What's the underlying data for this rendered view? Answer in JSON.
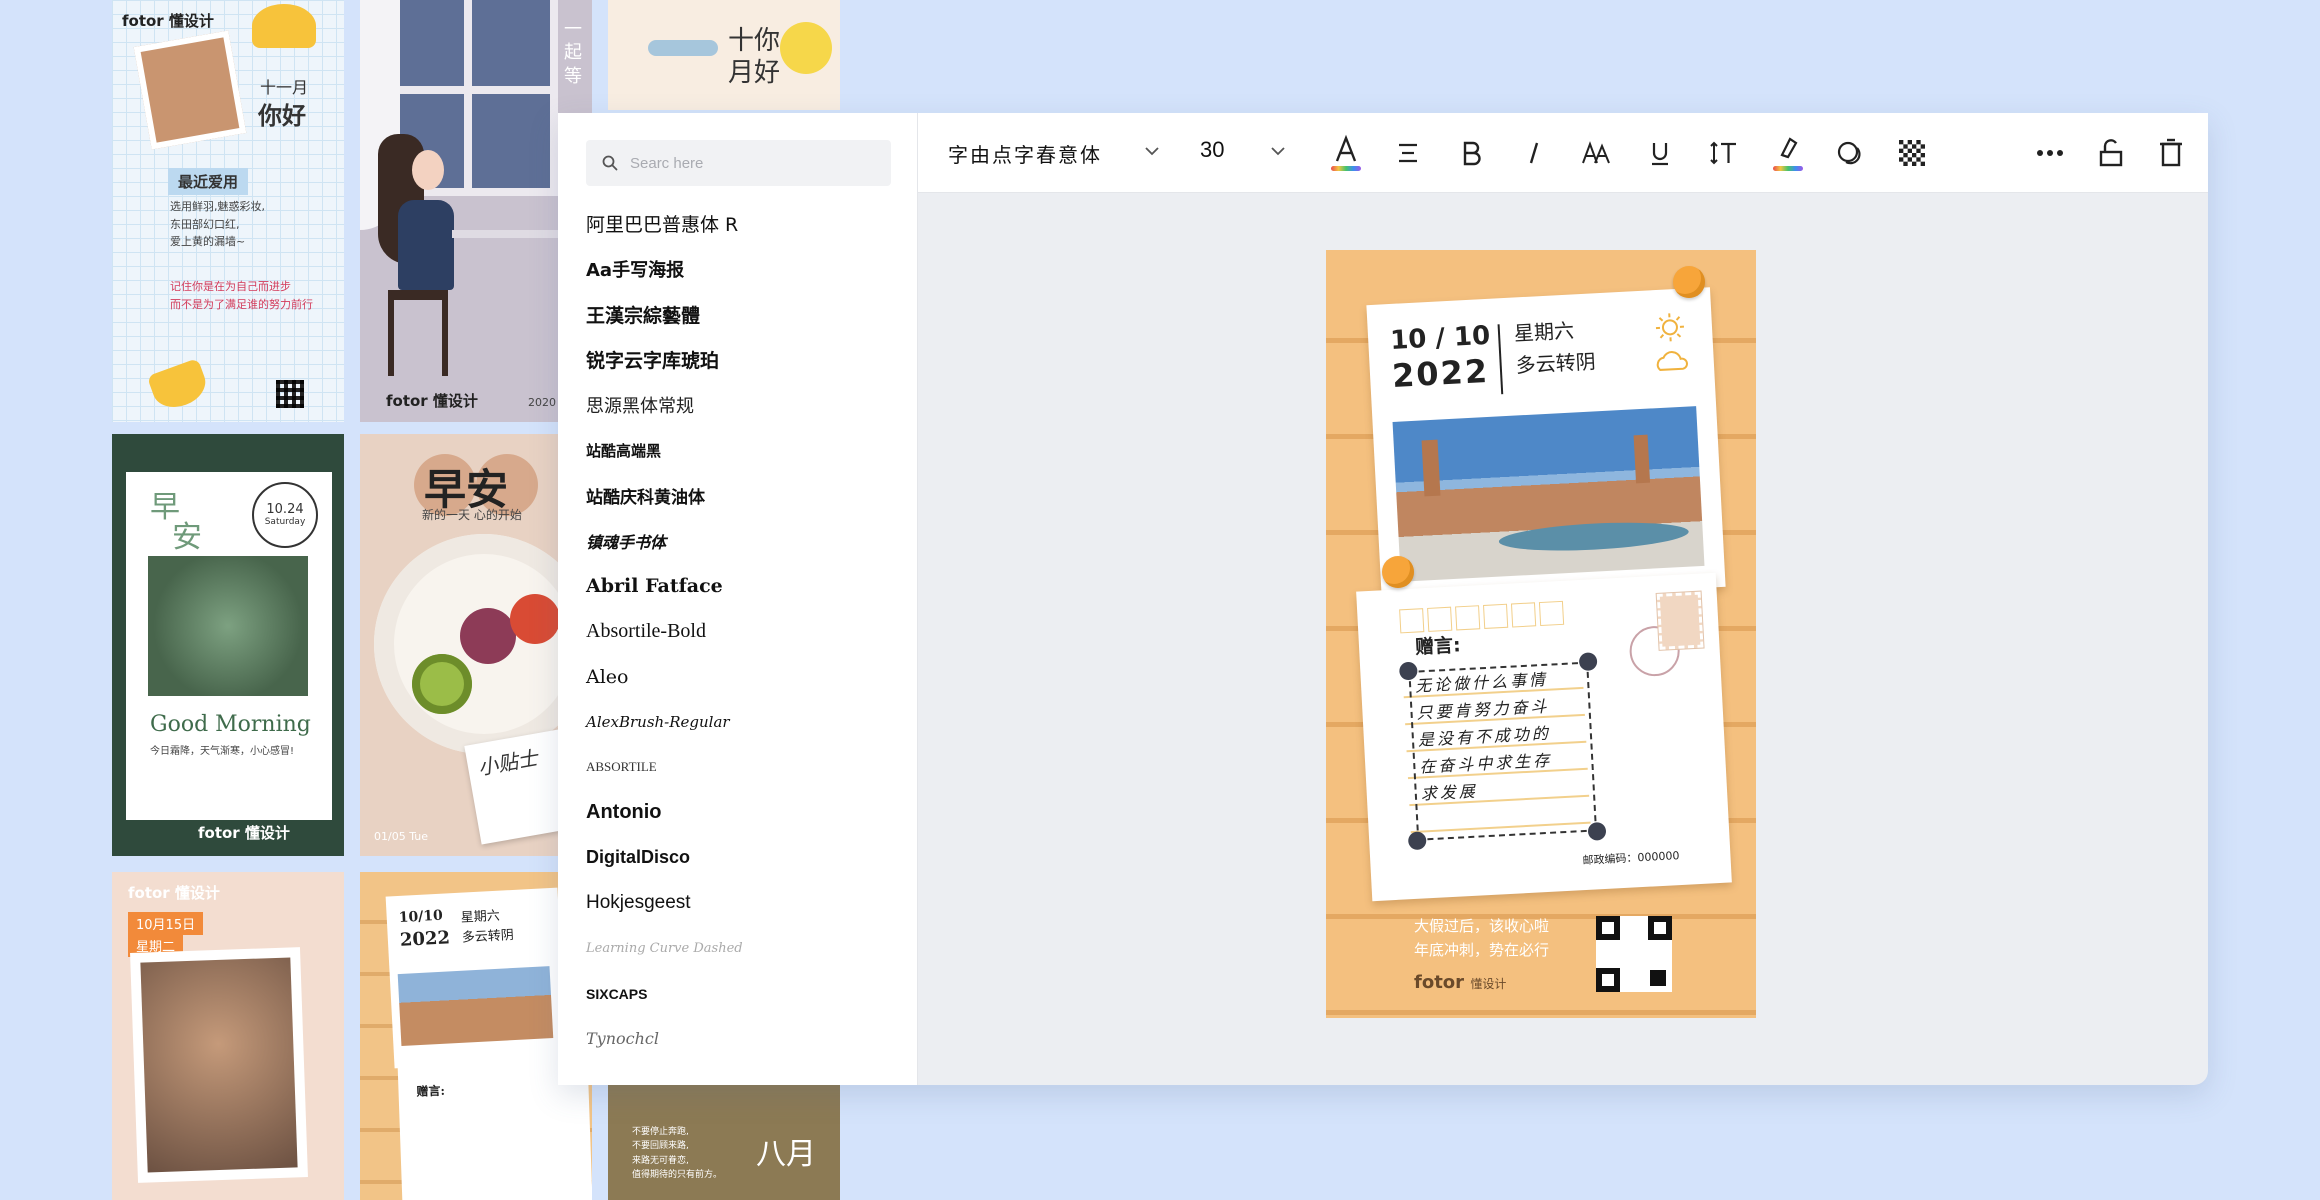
{
  "gallery": {
    "t1": {
      "brand": "fotor 懂设计",
      "title_month": "十一月",
      "title_hello": "你好",
      "tag": "最近爱用",
      "lines": [
        "选用鲜羽,魅惑彩妆,",
        "东田部幻口红,",
        "爱上黄的漏墙~"
      ],
      "footer1": "记住你是在为自己而进步",
      "footer2": "而不是为了满足谁的努力前行"
    },
    "t2": {
      "vertical": "一起等",
      "brand": "fotor 懂设计",
      "date": "2020"
    },
    "t3": {
      "title1": "十你",
      "title2": "月好"
    },
    "t4": {
      "early": "早",
      "morning": "安",
      "date": "10.24",
      "weekday": "Saturday",
      "greeting": "Good Morning",
      "sub": "今日霜降，天气渐寒，小心感冒!",
      "brand": "fotor 懂设计"
    },
    "t5": {
      "title": "早安",
      "sub": "新的一天 心的开始",
      "note": "小贴士",
      "date": "01/05 Tue"
    },
    "t7": {
      "brand": "fotor 懂设计",
      "date": "10月15日",
      "weekday": "星期二"
    },
    "t8": {
      "date": "10/10",
      "year": "2022",
      "weekday": "星期六",
      "weather": "多云转阴",
      "gift": "赠言:"
    },
    "t9": {
      "title": "八月",
      "lines": [
        "不要停止奔跑,",
        "不要回顾来路,",
        "来路无可眷恋,",
        "值得期待的只有前方。"
      ]
    }
  },
  "search": {
    "placeholder": "Searc here"
  },
  "fonts": [
    {
      "name": "阿里巴巴普惠体 R",
      "family": "\"DejaVu Sans\", sans-serif",
      "size": 19,
      "weight": "normal",
      "style": "normal",
      "color": "#111"
    },
    {
      "name": "Aa手写海报",
      "family": "\"DejaVu Sans\", sans-serif",
      "size": 18,
      "weight": "bold",
      "style": "normal",
      "color": "#111"
    },
    {
      "name": "王漢宗綜藝體",
      "family": "\"DejaVu Serif\", serif",
      "size": 19,
      "weight": "bold",
      "style": "normal",
      "color": "#111"
    },
    {
      "name": "锐字云字库琥珀",
      "family": "\"DejaVu Sans\", sans-serif",
      "size": 19,
      "weight": "bold",
      "style": "normal",
      "color": "#111"
    },
    {
      "name": "思源黑体常规",
      "family": "\"DejaVu Sans\", sans-serif",
      "size": 18,
      "weight": "normal",
      "style": "normal",
      "color": "#222"
    },
    {
      "name": "站酷高端黑",
      "family": "\"DejaVu Sans\", sans-serif",
      "size": 15,
      "weight": "bold",
      "style": "normal",
      "color": "#111"
    },
    {
      "name": "站酷庆科黄油体",
      "family": "\"DejaVu Sans\", sans-serif",
      "size": 17,
      "weight": "bold",
      "style": "normal",
      "color": "#111"
    },
    {
      "name": "镇魂手书体",
      "family": "\"DejaVu Serif\", serif",
      "size": 16,
      "weight": "bold",
      "style": "italic",
      "color": "#111"
    },
    {
      "name": "Abril Fatface",
      "family": "\"DejaVu Serif\", serif",
      "size": 19,
      "weight": "bold",
      "style": "normal",
      "color": "#111"
    },
    {
      "name": "Absortile-Bold",
      "family": "\"Liberation Serif\", serif",
      "size": 20,
      "weight": "normal",
      "style": "normal",
      "color": "#111"
    },
    {
      "name": "Aleo",
      "family": "\"DejaVu Serif\", serif",
      "size": 19,
      "weight": "normal",
      "style": "normal",
      "color": "#111"
    },
    {
      "name": "AlexBrush-Regular",
      "family": "\"DejaVu Serif\", serif",
      "size": 15,
      "weight": "normal",
      "style": "italic",
      "color": "#111"
    },
    {
      "name": "ABSORTILE",
      "family": "\"Liberation Serif\", serif",
      "size": 13,
      "weight": "normal",
      "style": "normal",
      "color": "#333"
    },
    {
      "name": "Antonio",
      "family": "\"Liberation Sans\", sans-serif",
      "size": 20,
      "weight": "bold",
      "style": "normal",
      "color": "#111"
    },
    {
      "name": "DigitalDisco",
      "family": "\"Liberation Sans\", sans-serif",
      "size": 18,
      "weight": "bold",
      "style": "normal",
      "color": "#111"
    },
    {
      "name": "Hokjesgeest",
      "family": "\"Liberation Sans\", sans-serif",
      "size": 19,
      "weight": "normal",
      "style": "normal",
      "color": "#111"
    },
    {
      "name": "Learning Curve Dashed",
      "family": "\"DejaVu Serif\", serif",
      "size": 13,
      "weight": "normal",
      "style": "italic",
      "color": "#aaa"
    },
    {
      "name": "SIXCAPS",
      "family": "\"Liberation Sans\", sans-serif",
      "size": 14,
      "weight": "bold",
      "style": "normal",
      "color": "#111"
    },
    {
      "name": "Tynochcl",
      "family": "\"DejaVu Serif\", serif",
      "size": 16,
      "weight": "normal",
      "style": "italic",
      "color": "#666"
    }
  ],
  "toolbar": {
    "font_name": "字由点字春意体",
    "font_size": "30",
    "icons": [
      "text-color-icon",
      "align-icon",
      "bold-icon",
      "italic-icon",
      "letter-case-icon",
      "underline-icon",
      "line-spacing-icon",
      "highlight-icon",
      "effects-icon",
      "transparency-icon",
      "more-icon",
      "unlock-icon",
      "delete-icon"
    ]
  },
  "poster": {
    "date": "10 / 10",
    "year": "2022",
    "weekday": "星期六",
    "weather": "多云转阴",
    "gift_label": "赠言:",
    "message": [
      "无论做什么事情",
      "只要肯努力奋斗",
      "是没有不成功的",
      "在奋斗中求生存",
      "求发展"
    ],
    "postcode": "邮政编码：000000",
    "footer": [
      "大假过后，该收心啦",
      "年底冲刺，势在必行"
    ],
    "brand": "fotor",
    "brand_sub": "懂设计"
  },
  "colors": {
    "background": "#d4e3fb",
    "poster_wood": "#f4c07f",
    "handle": "#3c4150",
    "pin": "#f7a53a"
  }
}
